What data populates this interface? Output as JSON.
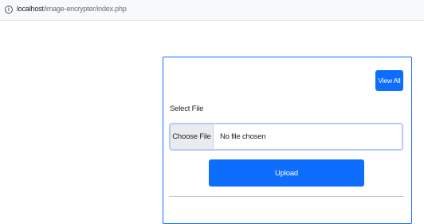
{
  "browser": {
    "url_host": "localhost",
    "url_path": "/image-encrypter/index.php"
  },
  "form": {
    "view_all_label": "View All",
    "select_file_label": "Select File",
    "choose_file_label": "Choose File",
    "file_status": "No file chosen",
    "upload_label": "Upload"
  },
  "colors": {
    "primary": "#0d6efd",
    "input_focus_border": "#b7cdf6"
  },
  "icons": {
    "address_info": "info-circle-icon"
  }
}
